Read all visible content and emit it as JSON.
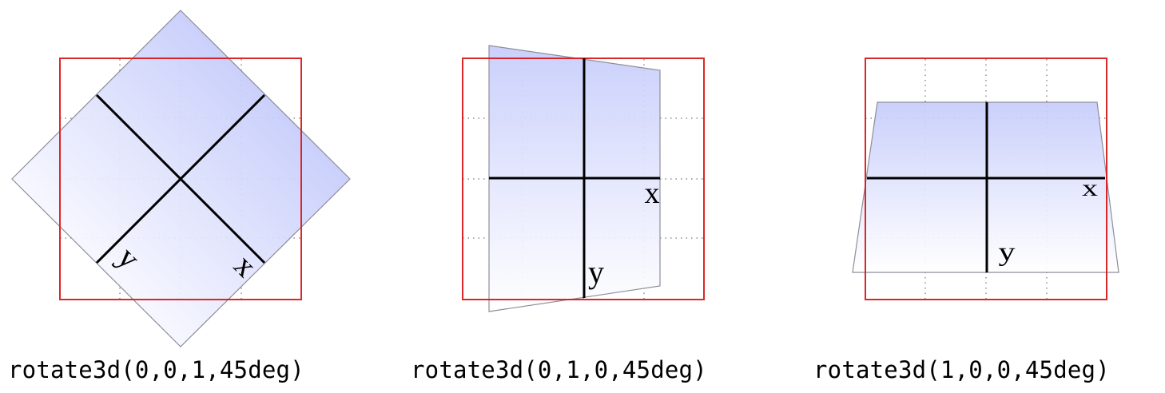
{
  "diagrams": [
    {
      "caption": "rotate3d(0,0,1,45deg)",
      "x_label": "x",
      "y_label": "y"
    },
    {
      "caption": "rotate3d(0,1,0,45deg)",
      "x_label": "x",
      "y_label": "y"
    },
    {
      "caption": "rotate3d(1,0,0,45deg)",
      "x_label": "x",
      "y_label": "y"
    }
  ],
  "colors": {
    "reference_box": "#d81b1b",
    "plane_top": "#c6ccfb",
    "plane_bottom": "#ffffff",
    "plane_border": "#8e8e9a",
    "axis": "#000000",
    "grid": "#555555"
  }
}
